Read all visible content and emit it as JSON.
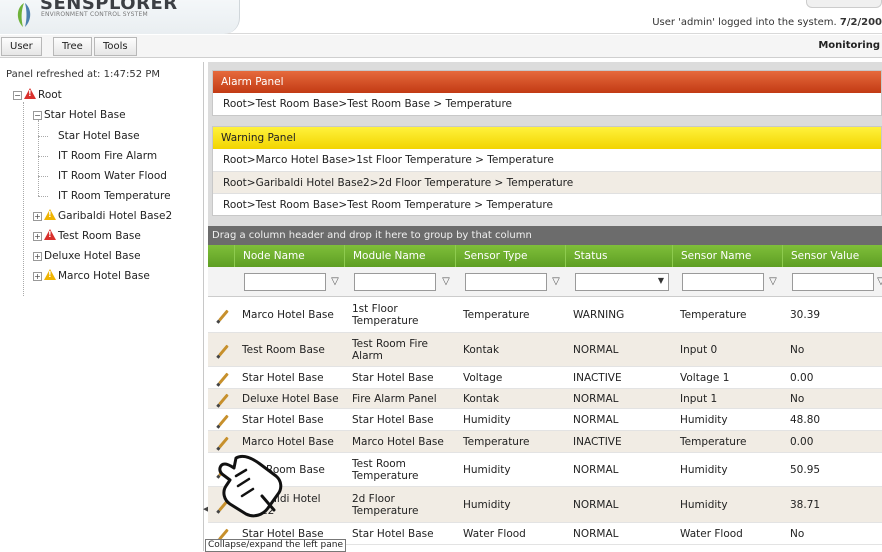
{
  "header": {
    "logo_title": "SENSPLORER",
    "logo_subtitle": "ENVIRONMENT CONTROL SYSTEM",
    "login_text": "User 'admin' logged into the system.",
    "login_date": "7/2/200",
    "logo_icon": "leaf-logo-icon"
  },
  "toolbar": {
    "menus": [
      "User",
      "Tree",
      "Tools"
    ],
    "view_label": "Monitoring"
  },
  "left_panel": {
    "refresh_text": "Panel refreshed at: 1:47:52 PM",
    "tree": [
      {
        "label": "Root",
        "level": 0,
        "expander": "−",
        "icon": "alarm-icon"
      },
      {
        "label": "Star Hotel Base",
        "level": 1,
        "expander": "−",
        "icon": ""
      },
      {
        "label": "Star Hotel Base",
        "level": 2,
        "expander": "",
        "icon": ""
      },
      {
        "label": "IT Room Fire Alarm",
        "level": 2,
        "expander": "",
        "icon": ""
      },
      {
        "label": "IT Room Water Flood",
        "level": 2,
        "expander": "",
        "icon": ""
      },
      {
        "label": "IT Room Temperature",
        "level": 2,
        "expander": "",
        "icon": ""
      },
      {
        "label": "Garibaldi Hotel Base2",
        "level": 1,
        "expander": "+",
        "icon": "warning-icon"
      },
      {
        "label": "Test Room Base",
        "level": 1,
        "expander": "+",
        "icon": "alarm-icon"
      },
      {
        "label": "Deluxe Hotel Base",
        "level": 1,
        "expander": "+",
        "icon": ""
      },
      {
        "label": "Marco Hotel Base",
        "level": 1,
        "expander": "+",
        "icon": "warning-icon"
      }
    ]
  },
  "alarm_panel": {
    "title": "Alarm Panel",
    "rows": [
      "Root>Test Room Base>Test Room Base > Temperature"
    ]
  },
  "warning_panel": {
    "title": "Warning Panel",
    "rows": [
      "Root>Marco Hotel Base>1st Floor Temperature > Temperature",
      "Root>Garibaldi Hotel Base2>2d Floor Temperature > Temperature",
      "Root>Test Room Base>Test Room Temperature > Temperature"
    ]
  },
  "grid": {
    "group_hint": "Drag a column header and drop it here to group by that column",
    "columns": [
      "Node Name",
      "Module Name",
      "Sensor Type",
      "Status",
      "Sensor Name",
      "Sensor Value"
    ],
    "rows": [
      [
        "Marco Hotel Base",
        "1st Floor Temperature",
        "Temperature",
        "WARNING",
        "Temperature",
        "30.39"
      ],
      [
        "Test Room Base",
        "Test Room Fire Alarm",
        "Kontak",
        "NORMAL",
        "Input 0",
        "No"
      ],
      [
        "Star Hotel Base",
        "Star Hotel Base",
        "Voltage",
        "INACTIVE",
        "Voltage 1",
        "0.00"
      ],
      [
        "Deluxe Hotel Base",
        "Fire Alarm Panel",
        "Kontak",
        "NORMAL",
        "Input 1",
        "No"
      ],
      [
        "Star Hotel Base",
        "Star Hotel Base",
        "Humidity",
        "NORMAL",
        "Humidity",
        "48.80"
      ],
      [
        "Marco Hotel Base",
        "Marco Hotel Base",
        "Temperature",
        "INACTIVE",
        "Temperature",
        "0.00"
      ],
      [
        "Test Room Base",
        "Test Room Temperature",
        "Humidity",
        "NORMAL",
        "Humidity",
        "50.95"
      ],
      [
        "Garibaldi Hotel Base2",
        "2d Floor Temperature",
        "Humidity",
        "NORMAL",
        "Humidity",
        "38.71"
      ],
      [
        "Star Hotel Base",
        "Star Hotel Base",
        "Water Flood",
        "NORMAL",
        "Water Flood",
        "No"
      ]
    ]
  },
  "tooltip": "Collapse/expand the left pane",
  "colors": {
    "alarm": "#c8401a",
    "warning": "#f2d400",
    "grid_header": "#6aab2c"
  }
}
